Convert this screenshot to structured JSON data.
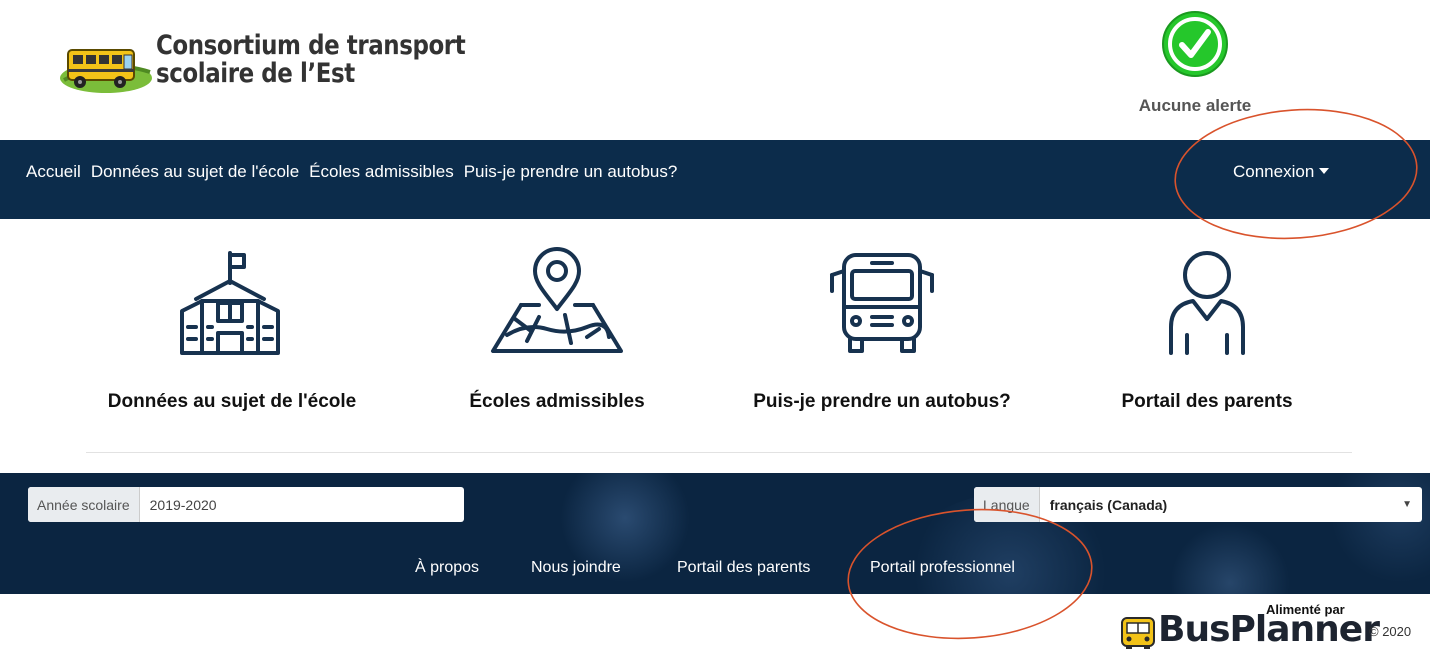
{
  "header": {
    "logo_line1": "Consortium de transport",
    "logo_line2": "scolaire de l’Est",
    "alert_status": "Aucune alerte",
    "alert_icon": "check-circle-icon"
  },
  "navbar": {
    "links": [
      "Accueil",
      "Données au sujet de l'école",
      "Écoles admissibles",
      "Puis-je prendre un autobus?"
    ],
    "login_label": "Connexion"
  },
  "tiles": [
    {
      "label": "Données au sujet de l'école",
      "icon": "school-icon"
    },
    {
      "label": "Écoles admissibles",
      "icon": "map-pin-icon"
    },
    {
      "label": "Puis-je prendre un autobus?",
      "icon": "bus-icon"
    },
    {
      "label": "Portail des parents",
      "icon": "parent-user-icon"
    }
  ],
  "footer": {
    "school_year_label": "Année scolaire",
    "school_year_value": "2019-2020",
    "language_label": "Langue",
    "language_value": "français (Canada)",
    "links": [
      "À propos",
      "Nous joindre",
      "Portail des parents",
      "Portail professionnel"
    ]
  },
  "powered": {
    "label": "Alimenté par",
    "brand": "BusPlanner",
    "copyright": "© 2020"
  },
  "colors": {
    "navbar": "#0c2c4b",
    "footer": "#0b2541",
    "alert_green": "#25c72b",
    "annotation": "#d9532c"
  }
}
